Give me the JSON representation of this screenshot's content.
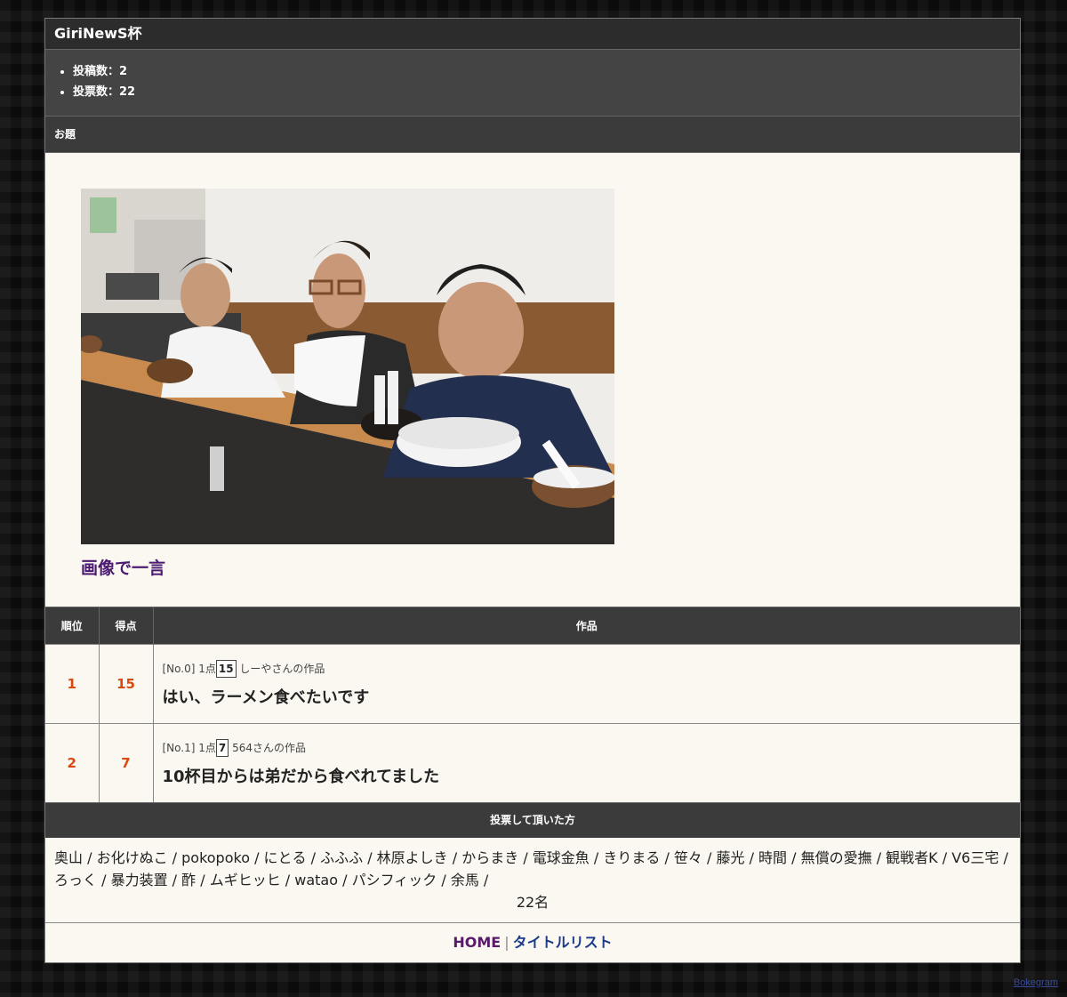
{
  "header": {
    "title": "GiriNewS杯"
  },
  "stats": {
    "posts": "投稿数：2",
    "votes": "投票数：22"
  },
  "odai": {
    "section_label": "お題",
    "image_icon": "photo-of-three-men-at-ramen-counter",
    "caption": "画像で一言"
  },
  "ranking": {
    "headers": {
      "rank": "順位",
      "score": "得点",
      "work": "作品"
    },
    "rows": [
      {
        "rank": "1",
        "score": "15",
        "meta_prefix": "[No.0] 1点",
        "meta_box": "15",
        "meta_author": "しーやさんの作品",
        "text": "はい、ラーメン食べたいです"
      },
      {
        "rank": "2",
        "score": "7",
        "meta_prefix": "[No.1] 1点",
        "meta_box": "7",
        "meta_author": "564さんの作品",
        "text": "10杯目からは弟だから食べれてました"
      }
    ]
  },
  "voters": {
    "section_label": "投票して頂いた方",
    "list": "奥山 / お化けぬこ / pokopoko / にとる / ふふふ / 林原よしき / からまき / 電球金魚 / きりまる / 笹々 / 藤光 / 時間 / 無償の愛撫 / 観戦者K / V6三宅 / ろっく / 暴力装置 / 酢 / ムギヒッヒ / watao / パシフィック / 余馬 /",
    "count": "22名"
  },
  "footer": {
    "home": "HOME",
    "separator": "|",
    "titles": "タイトルリスト"
  },
  "branding": {
    "bokegram": "Bokegram"
  },
  "colors": {
    "accent_rank": "#d9480f",
    "header_bg": "#3b3b3b",
    "content_bg": "#faf8f1"
  }
}
